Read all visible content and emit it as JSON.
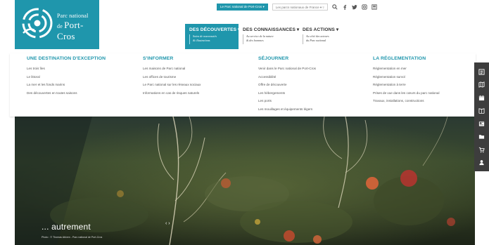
{
  "header": {
    "logo_line1": "Parc national",
    "logo_line2_prefix": "de",
    "logo_line2_name": "Port-Cros",
    "network_button": "Le Parc national de Port-Cros ▾",
    "parks_select": "Les parcs nationaux de France ▾  ▿",
    "utility_icons": [
      "search-icon",
      "facebook-icon",
      "twitter-icon",
      "instagram-icon",
      "newsletter-icon"
    ]
  },
  "main_nav": [
    {
      "label": "DES DÉCOUVERTES ▾",
      "sub": [
        "Soins de nouveautés",
        "& illustrations"
      ]
    },
    {
      "label": "DES CONNAISSANCES ▾",
      "sub": [
        "Au service de la nature",
        "& des hommes"
      ]
    },
    {
      "label": "DES ACTIONS ▾",
      "sub": [
        "Au côté des acteurs",
        "du Parc national"
      ]
    }
  ],
  "mega_menu": {
    "col1": {
      "heading": "UNE DESTINATION D'EXCEPTION",
      "items": [
        "Les trois îles",
        "Le littoral",
        "La mer et les fonds marins",
        "Des découvertes en toutes saisons"
      ]
    },
    "col2": {
      "heading": "S'INFORMER",
      "items": [
        "Les maisons de Parc national",
        "Les offices de tourisme",
        "Le Parc national sur les réseaux sociaux",
        "Informations en cas de risques naturels"
      ]
    },
    "col3": {
      "heading": "SÉJOURNER",
      "items": [
        "Venir dans le Parc national de Port-Cros",
        "Accessibilité",
        "Offre de découverte",
        "Les hébergements",
        "Les ports",
        "Les mouillages et équipements légers"
      ]
    },
    "col4": {
      "heading": "LA RÉGLEMENTATION",
      "items": [
        "Réglementation en mer",
        "Réglementation survol",
        "Réglementation à terre",
        "Prises de vue dans les cœurs du parc national",
        "Travaux, installations, constructions"
      ]
    }
  },
  "hero": {
    "caption": "... autrement",
    "credit": "Photo : © Thomas Abiven - Parc national de Port-Cros",
    "arrows": "‹ ›"
  },
  "side_tools": [
    "agenda-icon",
    "map-icon",
    "calendar-icon",
    "book-icon",
    "newspaper-icon",
    "folder-icon",
    "cart-icon",
    "user-icon"
  ],
  "colors": {
    "brand": "#1f96ac",
    "toolbar": "#3d3d3d"
  }
}
